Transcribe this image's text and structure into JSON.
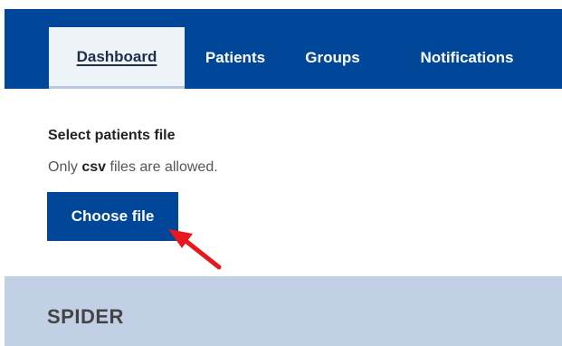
{
  "nav": {
    "tabs": [
      {
        "label": "Dashboard",
        "active": true
      },
      {
        "label": "Patients",
        "active": false
      },
      {
        "label": "Groups",
        "active": false
      },
      {
        "label": "Notifications",
        "active": false
      }
    ]
  },
  "upload": {
    "label": "Select patients file",
    "hint_prefix": "Only ",
    "hint_emphasis": "csv",
    "hint_suffix": " files are allowed.",
    "button_label": "Choose file"
  },
  "annotation": {
    "icon": "red-arrow-icon",
    "color": "#e8191c"
  },
  "footer": {
    "brand": "SPIDER"
  },
  "colors": {
    "primary": "#004699",
    "active_tab_bg": "#eef3f8",
    "band": "#c1d0e5"
  }
}
